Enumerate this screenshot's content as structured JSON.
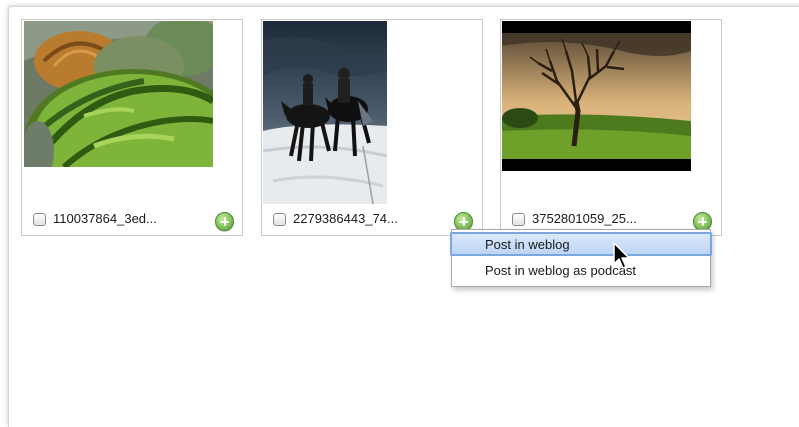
{
  "gallery": {
    "items": [
      {
        "filename": "110037864_3ed...",
        "image": "watermelon-pumpkins-photo"
      },
      {
        "filename": "2279386443_74...",
        "image": "horse-riders-snow-photo"
      },
      {
        "filename": "3752801059_25...",
        "image": "bare-tree-field-photo"
      }
    ]
  },
  "context_menu": {
    "items": [
      {
        "label": "Post in weblog",
        "highlighted": true
      },
      {
        "label": "Post in weblog as podcast",
        "highlighted": false
      }
    ]
  },
  "colors": {
    "highlight": "#bed5f5",
    "highlight_border": "#7aa7dd",
    "add_button": "#8cc965"
  },
  "icons": {
    "add": "plus-circle-icon",
    "pointer": "arrow-cursor-icon"
  }
}
